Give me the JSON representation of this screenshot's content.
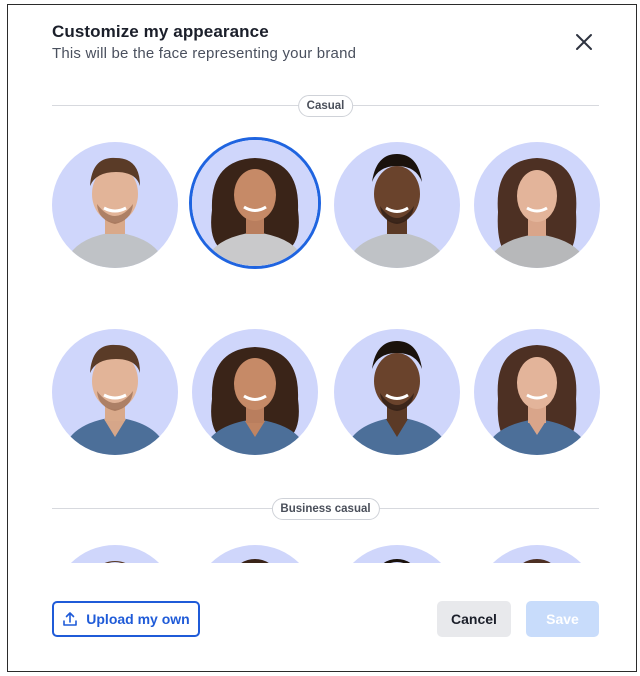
{
  "dialog": {
    "title": "Customize my appearance",
    "subtitle": "This will be the face representing your brand",
    "close_icon": "close-icon"
  },
  "sections": [
    {
      "label": "Casual"
    },
    {
      "label": "Business casual"
    }
  ],
  "selected_avatar_index": 1,
  "colors": {
    "accent": "#1f64e0",
    "avatar_background": "#cfd6fb",
    "save_disabled": "#c8dcfb",
    "cancel_background": "#e8e9ec"
  },
  "footer": {
    "upload_label": "Upload my own",
    "upload_icon": "upload-icon",
    "cancel_label": "Cancel",
    "save_label": "Save"
  }
}
